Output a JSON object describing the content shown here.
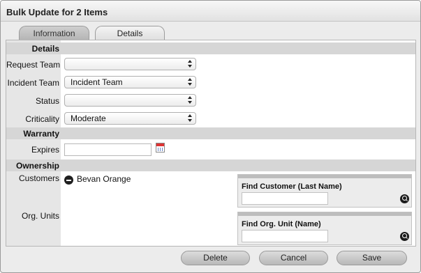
{
  "dialog": {
    "title": "Bulk Update for 2 Items"
  },
  "tabs": [
    {
      "label": "Information",
      "active": false
    },
    {
      "label": "Details",
      "active": true
    }
  ],
  "sections": {
    "details": "Details",
    "warranty": "Warranty",
    "ownership": "Ownership"
  },
  "fields": {
    "request_team": {
      "label": "Request Team",
      "value": ""
    },
    "incident_team": {
      "label": "Incident Team",
      "value": "Incident Team"
    },
    "status": {
      "label": "Status",
      "value": ""
    },
    "criticality": {
      "label": "Criticality",
      "value": "Moderate"
    },
    "expires": {
      "label": "Expires",
      "value": ""
    },
    "customers": {
      "label": "Customers",
      "items": [
        "Bevan Orange"
      ]
    },
    "org_units": {
      "label": "Org. Units"
    }
  },
  "find_customer": {
    "title": "Find Customer (Last Name)",
    "value": ""
  },
  "find_org_unit": {
    "title": "Find Org. Unit (Name)",
    "value": ""
  },
  "buttons": {
    "delete": "Delete",
    "cancel": "Cancel",
    "save": "Save"
  },
  "icons": {
    "calendar": "calendar-icon",
    "remove": "minus-circle-icon",
    "search": "magnifier-icon",
    "select_arrows": "up-down-arrows-icon"
  },
  "colors": {
    "section_bar": "#d6d6d6",
    "label_column": "#e6e6e6",
    "background": "#ececec"
  }
}
